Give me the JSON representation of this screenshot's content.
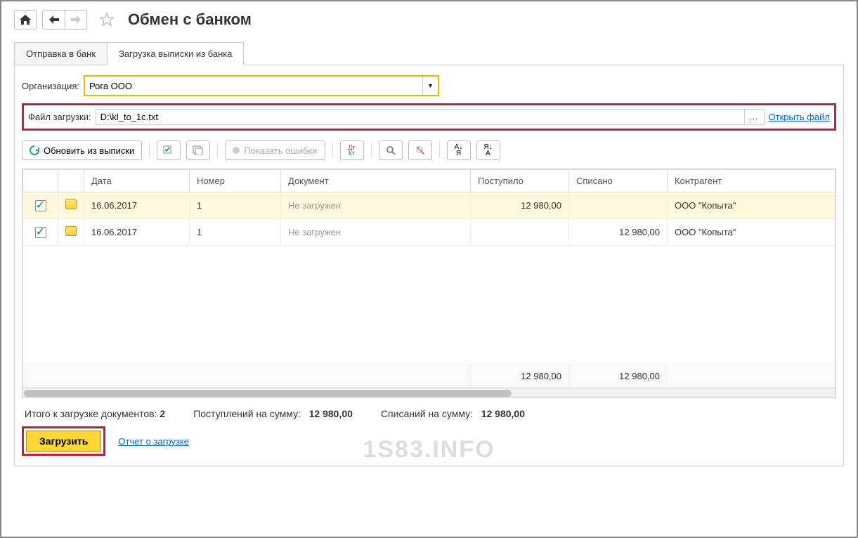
{
  "header": {
    "title": "Обмен с банком"
  },
  "tabs": {
    "send": "Отправка в банк",
    "load": "Загрузка выписки из банка"
  },
  "form": {
    "org_label": "Организация:",
    "org_value": "Рога ООО",
    "file_label": "Файл загрузки:",
    "file_value": "D:\\kl_to_1c.txt",
    "open_file": "Открыть файл"
  },
  "toolbar": {
    "refresh": "Обновить из выписки",
    "show_errors": "Показать ошибки"
  },
  "table": {
    "headers": {
      "date": "Дата",
      "number": "Номер",
      "document": "Документ",
      "received": "Поступило",
      "debited": "Списано",
      "counterparty": "Контрагент"
    },
    "rows": [
      {
        "checked": true,
        "date": "16.06.2017",
        "number": "1",
        "document": "Не загружен",
        "received": "12 980,00",
        "debited": "",
        "counterparty": "ООО \"Копыта\"",
        "selected": true
      },
      {
        "checked": true,
        "date": "16.06.2017",
        "number": "1",
        "document": "Не загружен",
        "received": "",
        "debited": "12 980,00",
        "counterparty": "ООО \"Копыта\"",
        "selected": false
      }
    ],
    "totals": {
      "received": "12 980,00",
      "debited": "12 980,00"
    }
  },
  "summary": {
    "docs_label": "Итого к загрузке документов:",
    "docs_count": "2",
    "received_label": "Поступлений на сумму:",
    "received_value": "12 980,00",
    "debited_label": "Списаний на сумму:",
    "debited_value": "12 980,00"
  },
  "footer": {
    "load_btn": "Загрузить",
    "report_link": "Отчет о загрузке"
  },
  "watermark": "1S83.INFO"
}
